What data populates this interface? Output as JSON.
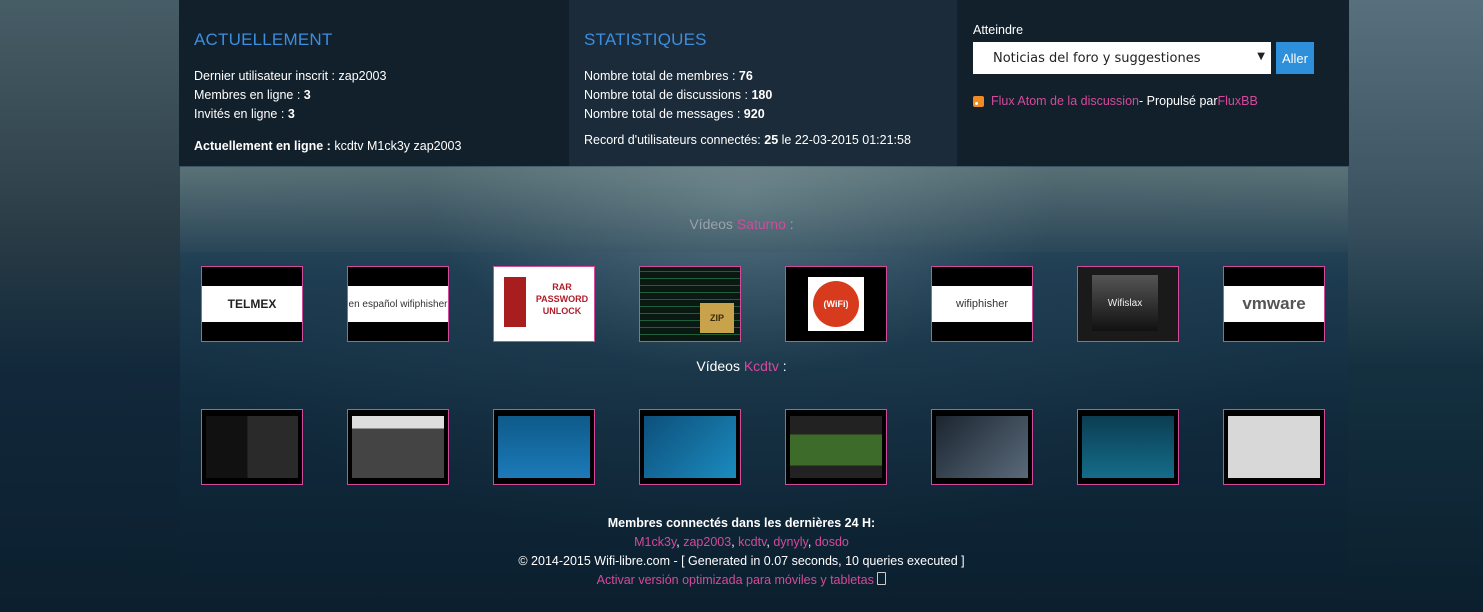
{
  "currently": {
    "heading": "ACTUELLEMENT",
    "last_user_label": "Dernier utilisateur inscrit : ",
    "last_user": "zap2003",
    "members_online_label": "Membres en ligne : ",
    "members_online": "3",
    "guests_online_label": "Invités en ligne : ",
    "guests_online": "3",
    "online_now_label": "Actuellement en ligne : ",
    "online_now": "kcdtv M1ck3y zap2003"
  },
  "stats": {
    "heading": "STATISTIQUES",
    "members_label": "Nombre total de membres : ",
    "members": "76",
    "topics_label": "Nombre total de discussions : ",
    "topics": "180",
    "posts_label": "Nombre total de messages : ",
    "posts": "920",
    "record_label": "Record d'utilisateurs connectés: ",
    "record_count": "25",
    "record_date": " le 22-03-2015 01:21:58"
  },
  "goto": {
    "label": "Atteindre",
    "selected": "Noticias del foro y suggestiones",
    "button": "Aller",
    "feed_link": "Flux Atom de la discussion",
    "powered_sep": " - Propulsé par ",
    "powered_link": "FluxBB"
  },
  "videos_saturno": {
    "prefix": "Vídeos ",
    "name": "Saturno",
    "suffix": " :",
    "items": [
      "TELMEX",
      "en español wifiphisher",
      "RAR PASSWORD UNLOCK",
      "ZIP",
      "(WiFi)",
      "wifiphisher",
      "Wifislax",
      "vmware"
    ]
  },
  "videos_kcdtv": {
    "prefix": "Vídeos ",
    "name": "Kcdtv",
    "suffix": " :"
  },
  "footer": {
    "connected_label": "Membres connectés dans les dernières 24 H:",
    "users": [
      "M1ck3y",
      "zap2003",
      "kcdtv",
      "dynyly",
      "dosdo"
    ],
    "copyright": "© 2014-2015 Wifi-libre.com - [ Generated in 0.07 seconds, 10 queries executed ]",
    "mobile_link": "Activar versión optimizada para móviles y tabletas"
  },
  "colors": {
    "accent_blue": "#3b8ee0",
    "link_pink": "#d44a9c",
    "button_blue": "#2e8fdb"
  }
}
